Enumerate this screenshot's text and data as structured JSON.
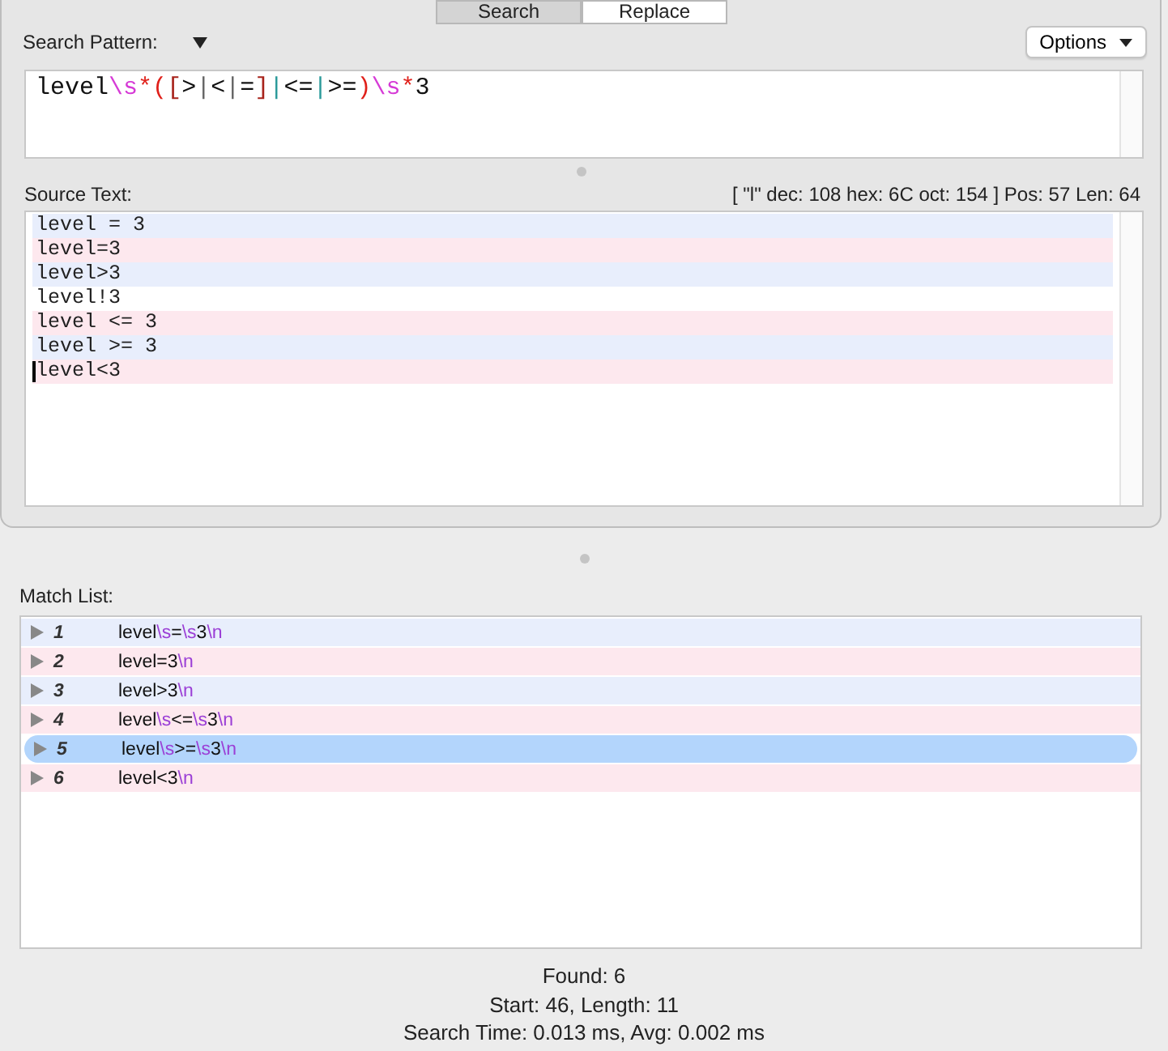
{
  "tabs": [
    {
      "label": "Search",
      "selected": true
    },
    {
      "label": "Replace",
      "selected": false
    }
  ],
  "search_pattern": {
    "label": "Search Pattern:",
    "options_button": "Options",
    "tokens": [
      {
        "text": "level",
        "kind": "plain"
      },
      {
        "text": "\\s",
        "kind": "escape"
      },
      {
        "text": "*",
        "kind": "quantifier"
      },
      {
        "text": "(",
        "kind": "group"
      },
      {
        "text": "[",
        "kind": "class"
      },
      {
        "text": ">",
        "kind": "plain"
      },
      {
        "text": "|",
        "kind": "literal_bar"
      },
      {
        "text": "<",
        "kind": "plain"
      },
      {
        "text": "|",
        "kind": "literal_bar"
      },
      {
        "text": "=",
        "kind": "plain"
      },
      {
        "text": "]",
        "kind": "class"
      },
      {
        "text": "|",
        "kind": "alternation"
      },
      {
        "text": "<=",
        "kind": "plain"
      },
      {
        "text": "|",
        "kind": "alternation"
      },
      {
        "text": ">=",
        "kind": "plain"
      },
      {
        "text": ")",
        "kind": "group"
      },
      {
        "text": "\\s",
        "kind": "escape"
      },
      {
        "text": "*",
        "kind": "quantifier"
      },
      {
        "text": "3",
        "kind": "plain"
      }
    ]
  },
  "source_text": {
    "label": "Source Text:",
    "char_info": "[ \"l\" dec: 108 hex: 6C oct: 154 ] Pos: 57 Len: 64",
    "lines": [
      {
        "text": "level = 3",
        "color": "#e8eefc",
        "cursor": false
      },
      {
        "text": "level=3",
        "color": "#fde8ee",
        "cursor": false
      },
      {
        "text": "level>3",
        "color": "#e8eefc",
        "cursor": false
      },
      {
        "text": "level!3",
        "color": "#ffffff",
        "cursor": false
      },
      {
        "text": "level <= 3",
        "color": "#fde8ee",
        "cursor": false
      },
      {
        "text": "level >= 3",
        "color": "#e8eefc",
        "cursor": false
      },
      {
        "text": "level<3",
        "color": "#fde8ee",
        "cursor": true
      }
    ]
  },
  "match_list": {
    "label": "Match List:",
    "rows": [
      {
        "number": "1",
        "color": "#e8eefc",
        "selected": false,
        "tokens": [
          {
            "text": "level",
            "kind": "plain"
          },
          {
            "text": "\\s",
            "kind": "escape"
          },
          {
            "text": "=",
            "kind": "plain"
          },
          {
            "text": "\\s",
            "kind": "escape"
          },
          {
            "text": "3",
            "kind": "plain"
          },
          {
            "text": "\\n",
            "kind": "escape"
          }
        ]
      },
      {
        "number": "2",
        "color": "#fde8ee",
        "selected": false,
        "tokens": [
          {
            "text": "level=3",
            "kind": "plain"
          },
          {
            "text": "\\n",
            "kind": "escape"
          }
        ]
      },
      {
        "number": "3",
        "color": "#e8eefc",
        "selected": false,
        "tokens": [
          {
            "text": "level>3",
            "kind": "plain"
          },
          {
            "text": "\\n",
            "kind": "escape"
          }
        ]
      },
      {
        "number": "4",
        "color": "#fde8ee",
        "selected": false,
        "tokens": [
          {
            "text": "level",
            "kind": "plain"
          },
          {
            "text": "\\s",
            "kind": "escape"
          },
          {
            "text": "<=",
            "kind": "plain"
          },
          {
            "text": "\\s",
            "kind": "escape"
          },
          {
            "text": "3",
            "kind": "plain"
          },
          {
            "text": "\\n",
            "kind": "escape"
          }
        ]
      },
      {
        "number": "5",
        "color": "#b3d5fc",
        "selected": true,
        "tokens": [
          {
            "text": "level",
            "kind": "plain"
          },
          {
            "text": "\\s",
            "kind": "escape"
          },
          {
            "text": ">=",
            "kind": "plain"
          },
          {
            "text": "\\s",
            "kind": "escape"
          },
          {
            "text": "3",
            "kind": "plain"
          },
          {
            "text": "\\n",
            "kind": "escape"
          }
        ]
      },
      {
        "number": "6",
        "color": "#fde8ee",
        "selected": false,
        "tokens": [
          {
            "text": "level<3",
            "kind": "plain"
          },
          {
            "text": "\\n",
            "kind": "escape"
          }
        ]
      }
    ]
  },
  "status": [
    "Found: 6",
    "Start: 46, Length: 11",
    "Search Time: 0.013 ms, Avg: 0.002 ms"
  ]
}
